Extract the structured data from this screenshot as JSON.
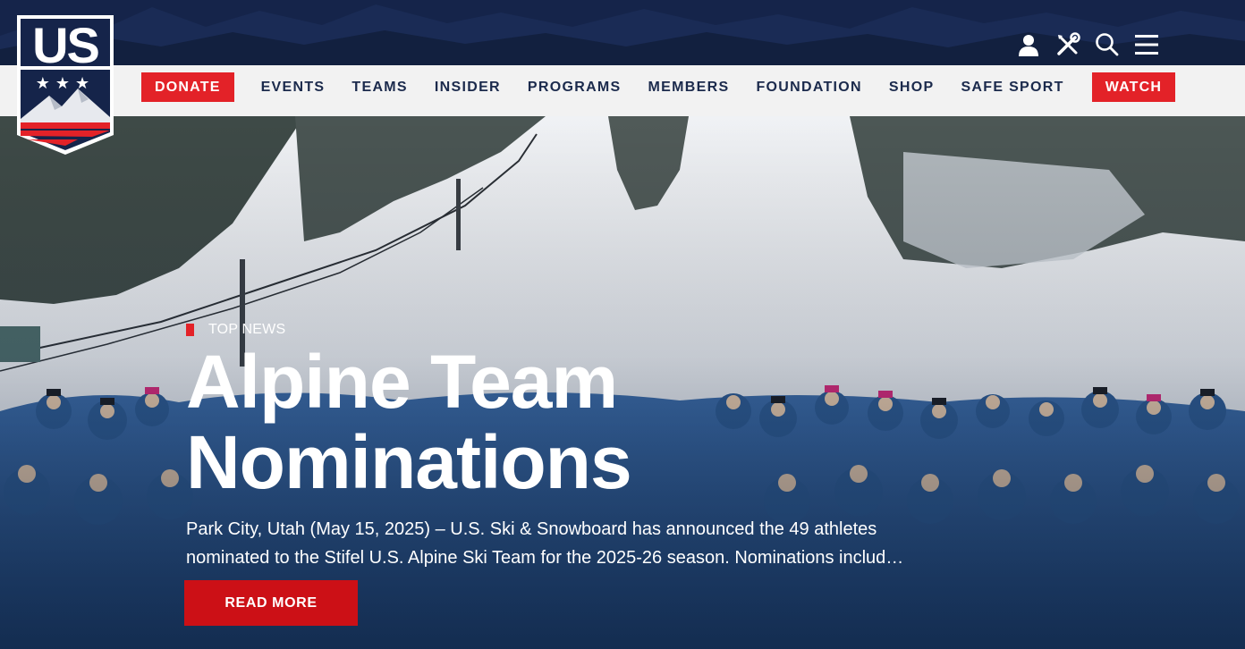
{
  "brand": {
    "logo_text": "US",
    "logo_stars": "★★★",
    "colors": {
      "navy": "#15244a",
      "red": "#e32228",
      "navbar_bg": "#f2f2f2"
    }
  },
  "utility": [
    {
      "icon": "user-icon"
    },
    {
      "icon": "tools-icon"
    },
    {
      "icon": "search-icon"
    },
    {
      "icon": "menu-icon"
    }
  ],
  "nav": {
    "donate": "DONATE",
    "items": [
      "EVENTS",
      "TEAMS",
      "INSIDER",
      "PROGRAMS",
      "MEMBERS",
      "FOUNDATION",
      "SHOP",
      "SAFE SPORT"
    ],
    "watch": "WATCH"
  },
  "hero": {
    "kicker": "TOP NEWS",
    "headline_line1": "Alpine Team",
    "headline_line2": "Nominations",
    "summary_line1": "Park City, Utah (May 15, 2025) – U.S. Ski & Snowboard has announced the 49 athletes",
    "summary_line2": "nominated to the Stifel U.S. Alpine Ski Team for the 2025-26 season. Nominations includ…",
    "cta": "READ MORE"
  }
}
